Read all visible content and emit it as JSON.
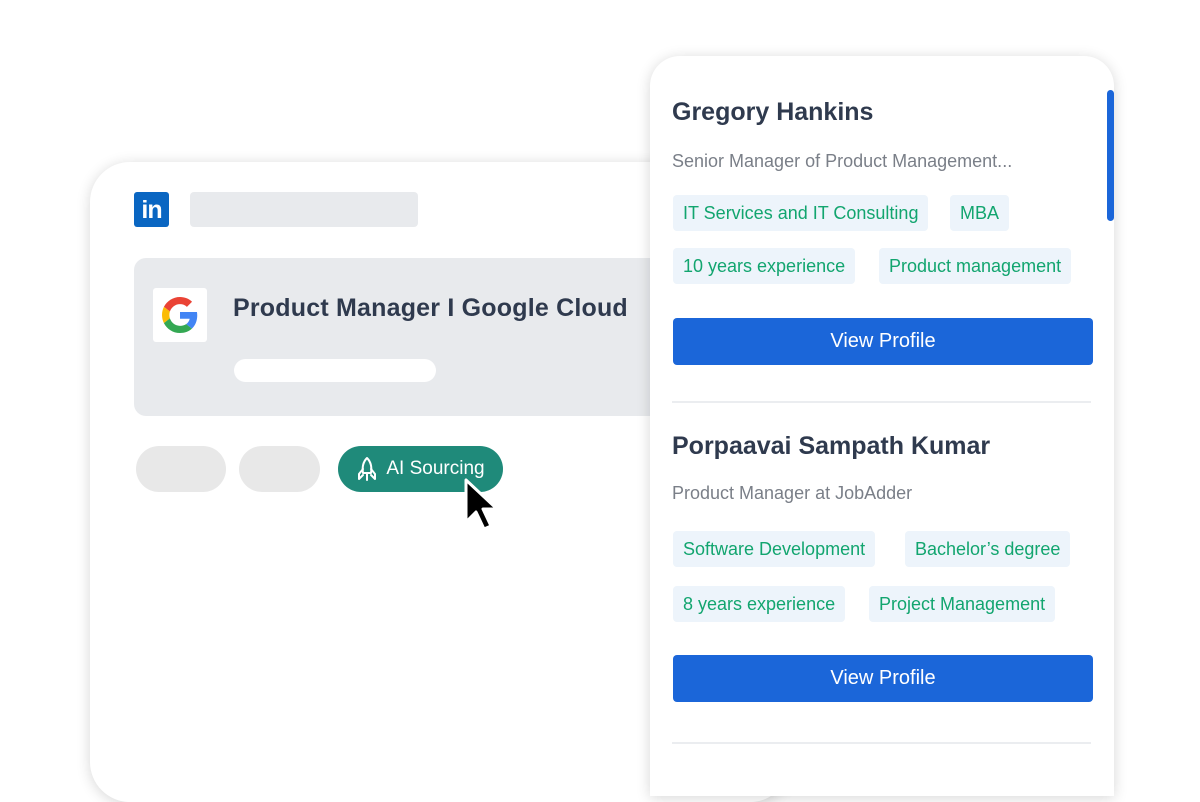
{
  "left_panel": {
    "brand_icon": "linkedin-icon",
    "job": {
      "company_icon": "google-icon",
      "title": "Product Manager I Google Cloud"
    },
    "ai_button": {
      "label": "AI Sourcing",
      "icon": "rocket-icon"
    }
  },
  "candidates": [
    {
      "name": "Gregory Hankins",
      "role": "Senior Manager of Product Management...",
      "tags": [
        "IT Services and IT Consulting",
        "MBA",
        "10 years experience",
        "Product management"
      ],
      "button_label": "View Profile"
    },
    {
      "name": "Porpaavai Sampath Kumar",
      "role": "Product Manager at JobAdder",
      "tags": [
        "Software Development",
        "Bachelor’s degree",
        "8 years experience",
        "Project Management"
      ],
      "button_label": "View Profile"
    }
  ],
  "colors": {
    "linkedin": "#0a66c2",
    "ai_button": "#1f8a7a",
    "primary_button": "#1b66d9",
    "tag_text": "#12a56f",
    "tag_bg": "#edf4fb"
  }
}
